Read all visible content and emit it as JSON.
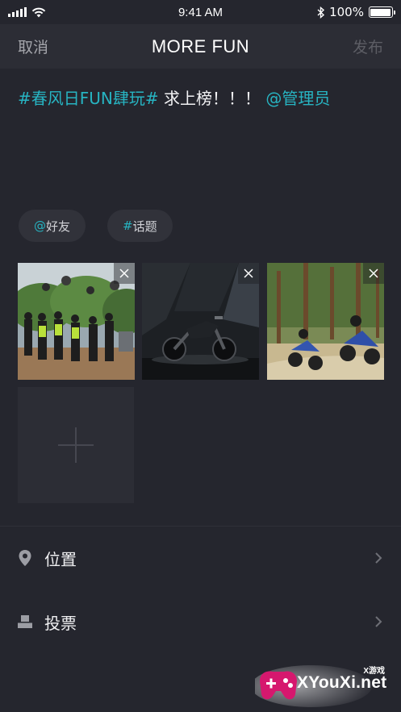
{
  "status_bar": {
    "time": "9:41 AM",
    "battery": "100%",
    "battery_level": 1.0
  },
  "nav": {
    "cancel": "取消",
    "title": "MORE FUN",
    "publish": "发布"
  },
  "post": {
    "hashtag": "#春风日FUN肆玩#",
    "body": " 求上榜！！！ ",
    "mention": "@管理员"
  },
  "chips": [
    {
      "symbol": "@",
      "label": "好友"
    },
    {
      "symbol": "#",
      "label": "话题"
    }
  ],
  "photos": [
    {
      "name": "group-riders-photo"
    },
    {
      "name": "motorcycle-studio-photo"
    },
    {
      "name": "motorcycle-racing-photo"
    }
  ],
  "options": {
    "location": "位置",
    "vote": "投票"
  },
  "watermark": {
    "small": "X游戏",
    "big": "XYouXi.net"
  },
  "colors": {
    "background": "#25262e",
    "nav_background": "#2c2d35",
    "accent": "#27b4c2",
    "muted_text": "#a4a5ab",
    "disabled_text": "#5c5d64"
  }
}
